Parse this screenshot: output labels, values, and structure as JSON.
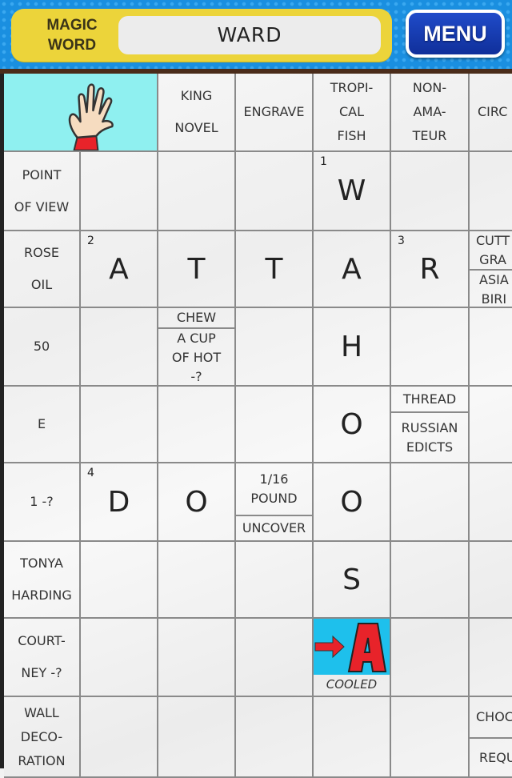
{
  "header": {
    "magic_label": "MAGIC\nWORD",
    "magic_word": "WARD",
    "menu_label": "MENU"
  },
  "colors": {
    "topbar_blue": "#1a8fe0",
    "magic_yellow": "#ecd43a",
    "menu_blue": "#1f4bc9",
    "hand_bg": "#8ff0f0",
    "arrow_bg": "#1ec0ec",
    "arrow_red": "#e8232a"
  },
  "grid": {
    "corner_icon": "waving-hand-icon",
    "column_clues": [
      {
        "text": "KING\nNOVEL"
      },
      {
        "text": "ENGRAVE"
      },
      {
        "text": "TROPI-\nCAL\nFISH"
      },
      {
        "text": "NON-\nAMA-\nTEUR"
      },
      {
        "text": "CIRC"
      }
    ],
    "rows": [
      {
        "clue": "POINT\nOF VIEW"
      },
      {
        "clue": "ROSE\nOIL"
      },
      {
        "clue": "50"
      },
      {
        "clue": "E"
      },
      {
        "clue": "1 -?"
      },
      {
        "clue": "TONYA\nHARDING"
      },
      {
        "clue": "COURT-\nNEY -?"
      },
      {
        "clue": "WALL\nDECO-\nRATION"
      }
    ],
    "letters": {
      "r0c4": {
        "letter": "W",
        "num": "1"
      },
      "r1c1": {
        "letter": "A",
        "num": "2"
      },
      "r1c2": {
        "letter": "T"
      },
      "r1c3": {
        "letter": "T"
      },
      "r1c4": {
        "letter": "A"
      },
      "r1c5": {
        "letter": "R",
        "num": "3"
      },
      "r2c4": {
        "letter": "H"
      },
      "r3c4": {
        "letter": "O"
      },
      "r4c1": {
        "letter": "D",
        "num": "4"
      },
      "r4c2": {
        "letter": "O"
      },
      "r4c4": {
        "letter": "O"
      },
      "r5c4": {
        "letter": "S"
      }
    },
    "inner_clues": {
      "r1c6": {
        "top": "CUTT\nGRA",
        "bottom": "ASIA\nBIRI"
      },
      "r2c2": {
        "top": "CHEW",
        "bottom": "A CUP\nOF HOT\n-?"
      },
      "r3c5": {
        "top": "THREAD",
        "bottom": "RUSSIAN\nEDICTS"
      },
      "r4c3": {
        "top": "1/16\nPOUND",
        "bottom": "UNCOVER"
      },
      "r7c6": {
        "top": "CHOC",
        "bottom": "REQU"
      }
    },
    "arrow_cell": {
      "icon": "arrow-right-letter-a-icon",
      "caption": "COOLED"
    }
  }
}
